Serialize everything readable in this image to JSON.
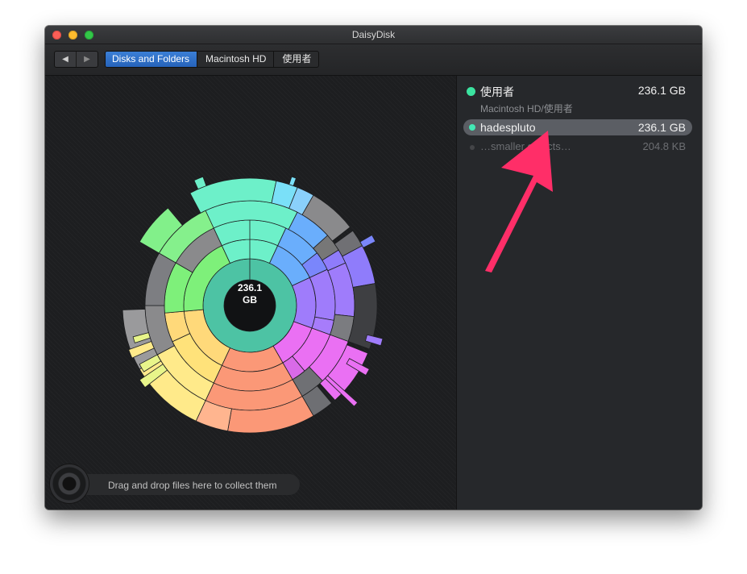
{
  "window": {
    "title": "DaisyDisk"
  },
  "toolbar": {
    "back_icon": "back-arrow-icon",
    "forward_icon": "forward-arrow-icon",
    "breadcrumbs": [
      "Disks and Folders",
      "Macintosh HD",
      "使用者"
    ]
  },
  "chart": {
    "center_line1": "236.1",
    "center_line2": "GB"
  },
  "collector": {
    "label": "Drag and drop files here to collect them"
  },
  "sidebar": {
    "header": {
      "name": "使用者",
      "size": "236.1 GB",
      "path": "Macintosh HD/使用者",
      "color": "#3be3a0"
    },
    "items": [
      {
        "name": "hadespluto",
        "size": "236.1 GB",
        "color": "#43e8b5",
        "selected": true
      },
      {
        "name": "…smaller objects…",
        "size": "204.8 KB",
        "color": "#555555",
        "selected": false
      }
    ]
  },
  "annotation": {
    "arrow_color": "#ff2e68"
  }
}
